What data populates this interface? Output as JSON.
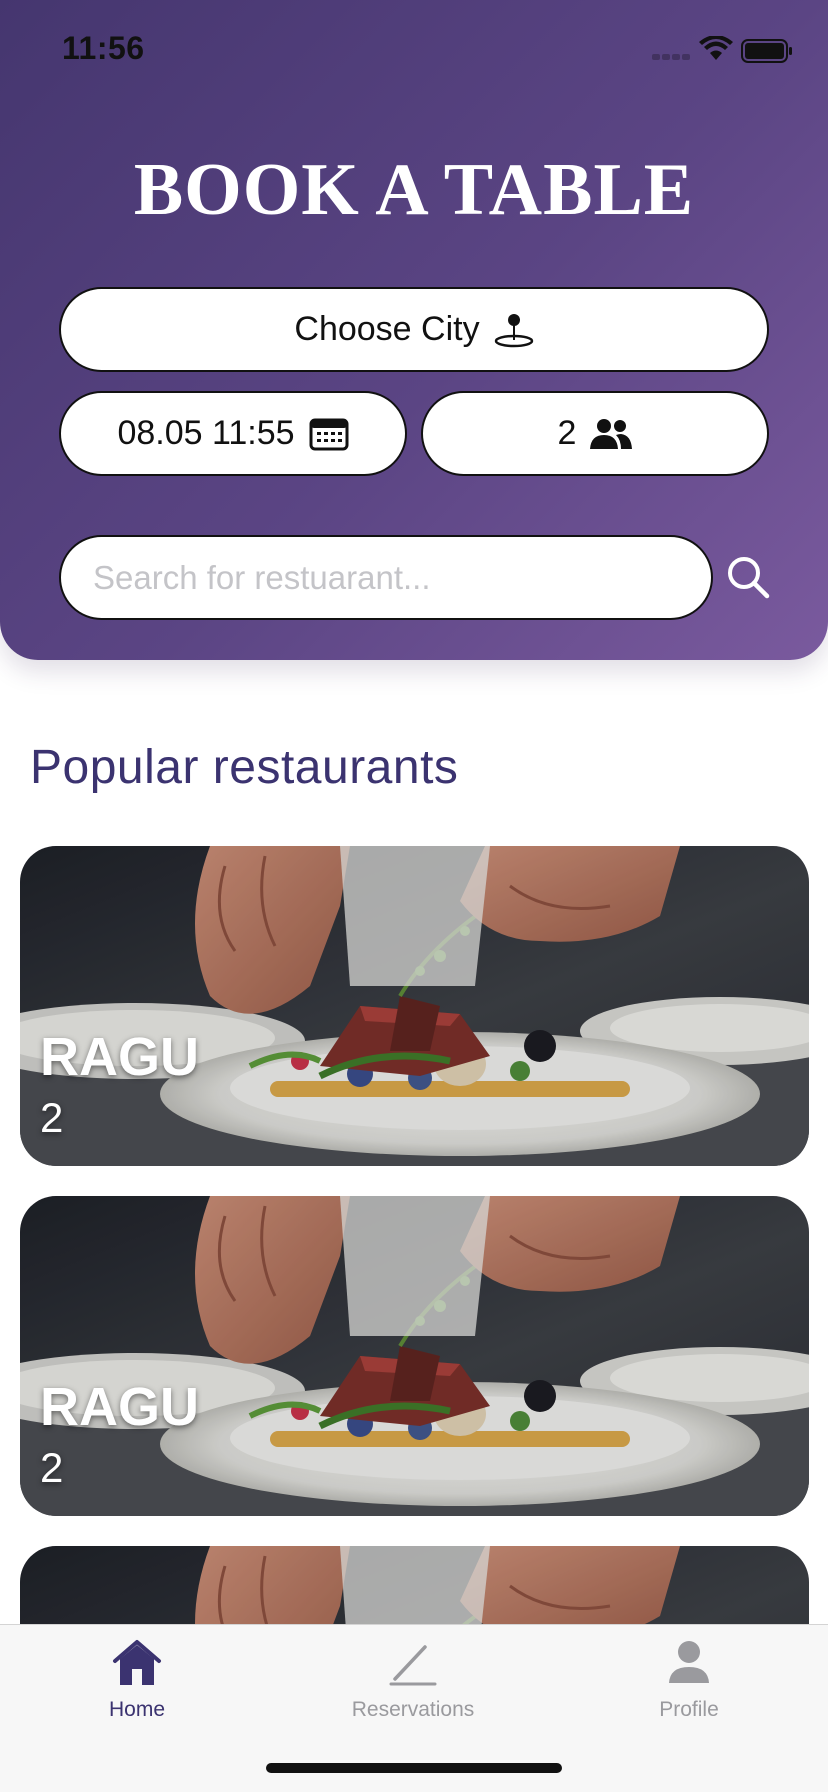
{
  "status_bar": {
    "time": "11:56"
  },
  "header": {
    "title": "BOOK A TABLE",
    "city_label": "Choose City",
    "datetime_label": "08.05 11:55",
    "guests_label": "2",
    "search": {
      "placeholder": "Search for restuarant...",
      "value": ""
    }
  },
  "section": {
    "title": "Popular restaurants"
  },
  "restaurants": [
    {
      "name": "RAGU",
      "subtitle": "2"
    },
    {
      "name": "RAGU",
      "subtitle": "2"
    },
    {
      "name": "",
      "subtitle": ""
    }
  ],
  "tabbar": {
    "items": [
      {
        "label": "Home",
        "icon": "home-icon",
        "active": true
      },
      {
        "label": "Reservations",
        "icon": "pencil-icon",
        "active": false
      },
      {
        "label": "Profile",
        "icon": "profile-icon",
        "active": false
      }
    ]
  },
  "colors": {
    "header_gradient_start": "#45366f",
    "header_gradient_end": "#7a5a9e",
    "accent": "#3b3370",
    "inactive_tab": "#9a9a9e"
  }
}
